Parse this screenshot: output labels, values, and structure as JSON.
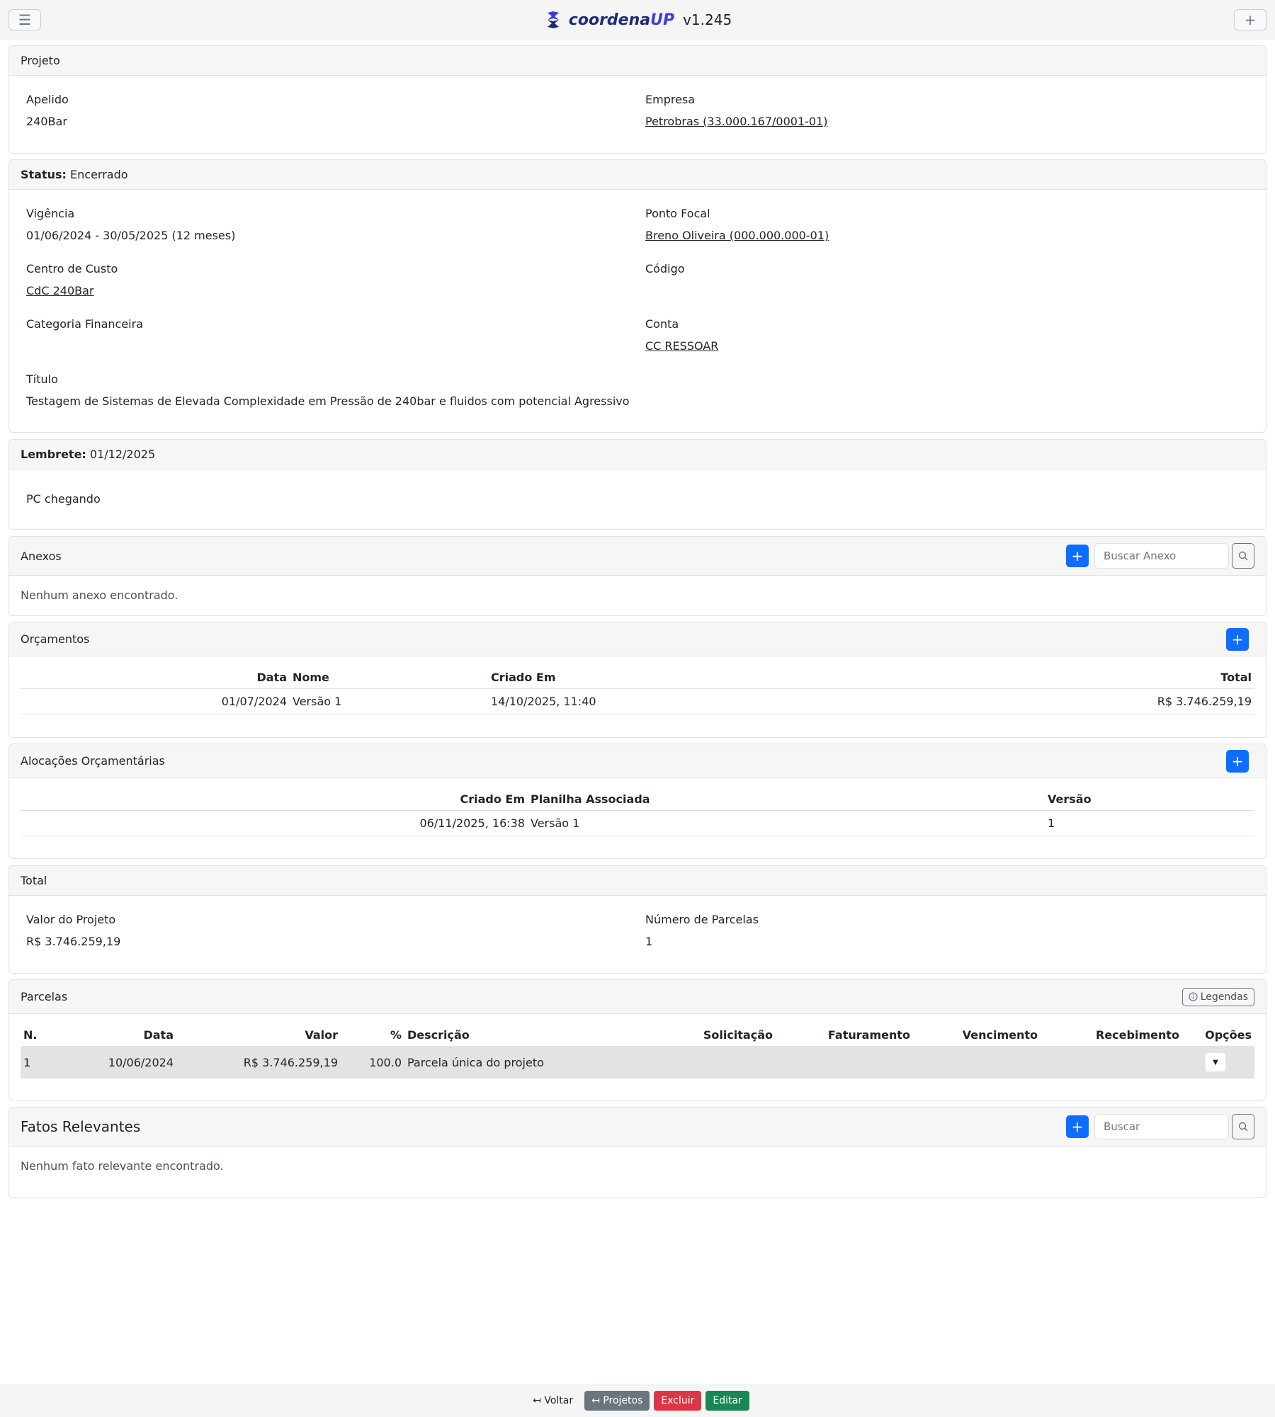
{
  "navbar": {
    "brand_prefix": "coordena",
    "brand_suffix": "UP",
    "version": "v1.245"
  },
  "projeto": {
    "header": "Projeto",
    "apelido_label": "Apelido",
    "apelido_value": "240Bar",
    "empresa_label": "Empresa",
    "empresa_value": "Petrobras (33.000.167/0001-01)"
  },
  "status": {
    "header_label": "Status:",
    "header_value": "Encerrado",
    "vigencia_label": "Vigência",
    "vigencia_value": "01/06/2024 - 30/05/2025 (12 meses)",
    "ponto_focal_label": "Ponto Focal",
    "ponto_focal_value": "Breno Oliveira (000.000.000-01)",
    "centro_custo_label": "Centro de Custo",
    "centro_custo_value": "CdC 240Bar",
    "codigo_label": "Código",
    "categoria_label": "Categoria Financeira",
    "conta_label": "Conta",
    "conta_value": "CC RESSOAR",
    "titulo_label": "Título",
    "titulo_value": "Testagem de Sistemas de Elevada Complexidade em Pressão de 240bar e fluidos com potencial Agressivo"
  },
  "lembrete": {
    "header_label": "Lembrete:",
    "header_value": "01/12/2025",
    "text": "PC chegando"
  },
  "anexos": {
    "header": "Anexos",
    "search_placeholder": "Buscar Anexo",
    "empty": "Nenhum anexo encontrado."
  },
  "orcamentos": {
    "header": "Orçamentos",
    "columns": {
      "data": "Data",
      "nome": "Nome",
      "criado_em": "Criado Em",
      "total": "Total"
    },
    "rows": [
      {
        "data": "01/07/2024",
        "nome": "Versão 1",
        "criado_em": "14/10/2025, 11:40",
        "total": "R$ 3.746.259,19"
      }
    ]
  },
  "alocacoes": {
    "header": "Alocações Orçamentárias",
    "columns": {
      "criado_em": "Criado Em",
      "planilha": "Planilha Associada",
      "versao": "Versão"
    },
    "rows": [
      {
        "criado_em": "06/11/2025, 16:38",
        "planilha": "Versão 1",
        "versao": "1"
      }
    ]
  },
  "total": {
    "header": "Total",
    "valor_label": "Valor do Projeto",
    "valor_value": "R$ 3.746.259,19",
    "parcelas_label": "Número de Parcelas",
    "parcelas_value": "1"
  },
  "parcelas": {
    "header": "Parcelas",
    "legend_label": "Legendas",
    "columns": {
      "n": "N.",
      "data": "Data",
      "valor": "Valor",
      "pct": "%",
      "descricao": "Descrição",
      "solicitacao": "Solicitação",
      "faturamento": "Faturamento",
      "vencimento": "Vencimento",
      "recebimento": "Recebimento",
      "opcoes": "Opções"
    },
    "rows": [
      {
        "n": "1",
        "data": "10/06/2024",
        "valor": "R$ 3.746.259,19",
        "pct": "100.0",
        "descricao": "Parcela única do projeto"
      }
    ]
  },
  "fatos": {
    "header": "Fatos Relevantes",
    "search_placeholder": "Buscar",
    "empty": "Nenhum fato relevante encontrado."
  },
  "footer": {
    "voltar": "Voltar",
    "projetos": "Projetos",
    "excluir": "Excluir",
    "editar": "Editar"
  },
  "icons": {
    "menu": "hamburger-menu-icon",
    "add": "plus-icon",
    "logo": "coordenaup-logo-icon",
    "search": "search-icon",
    "info": "info-circle-icon",
    "caret": "caret-down-icon",
    "back": "arrow-back-icon"
  },
  "colors": {
    "primary": "#0d6efd",
    "danger": "#dc3545",
    "success": "#198754",
    "secondary": "#6c757d",
    "brand": "#3b3fd8"
  }
}
